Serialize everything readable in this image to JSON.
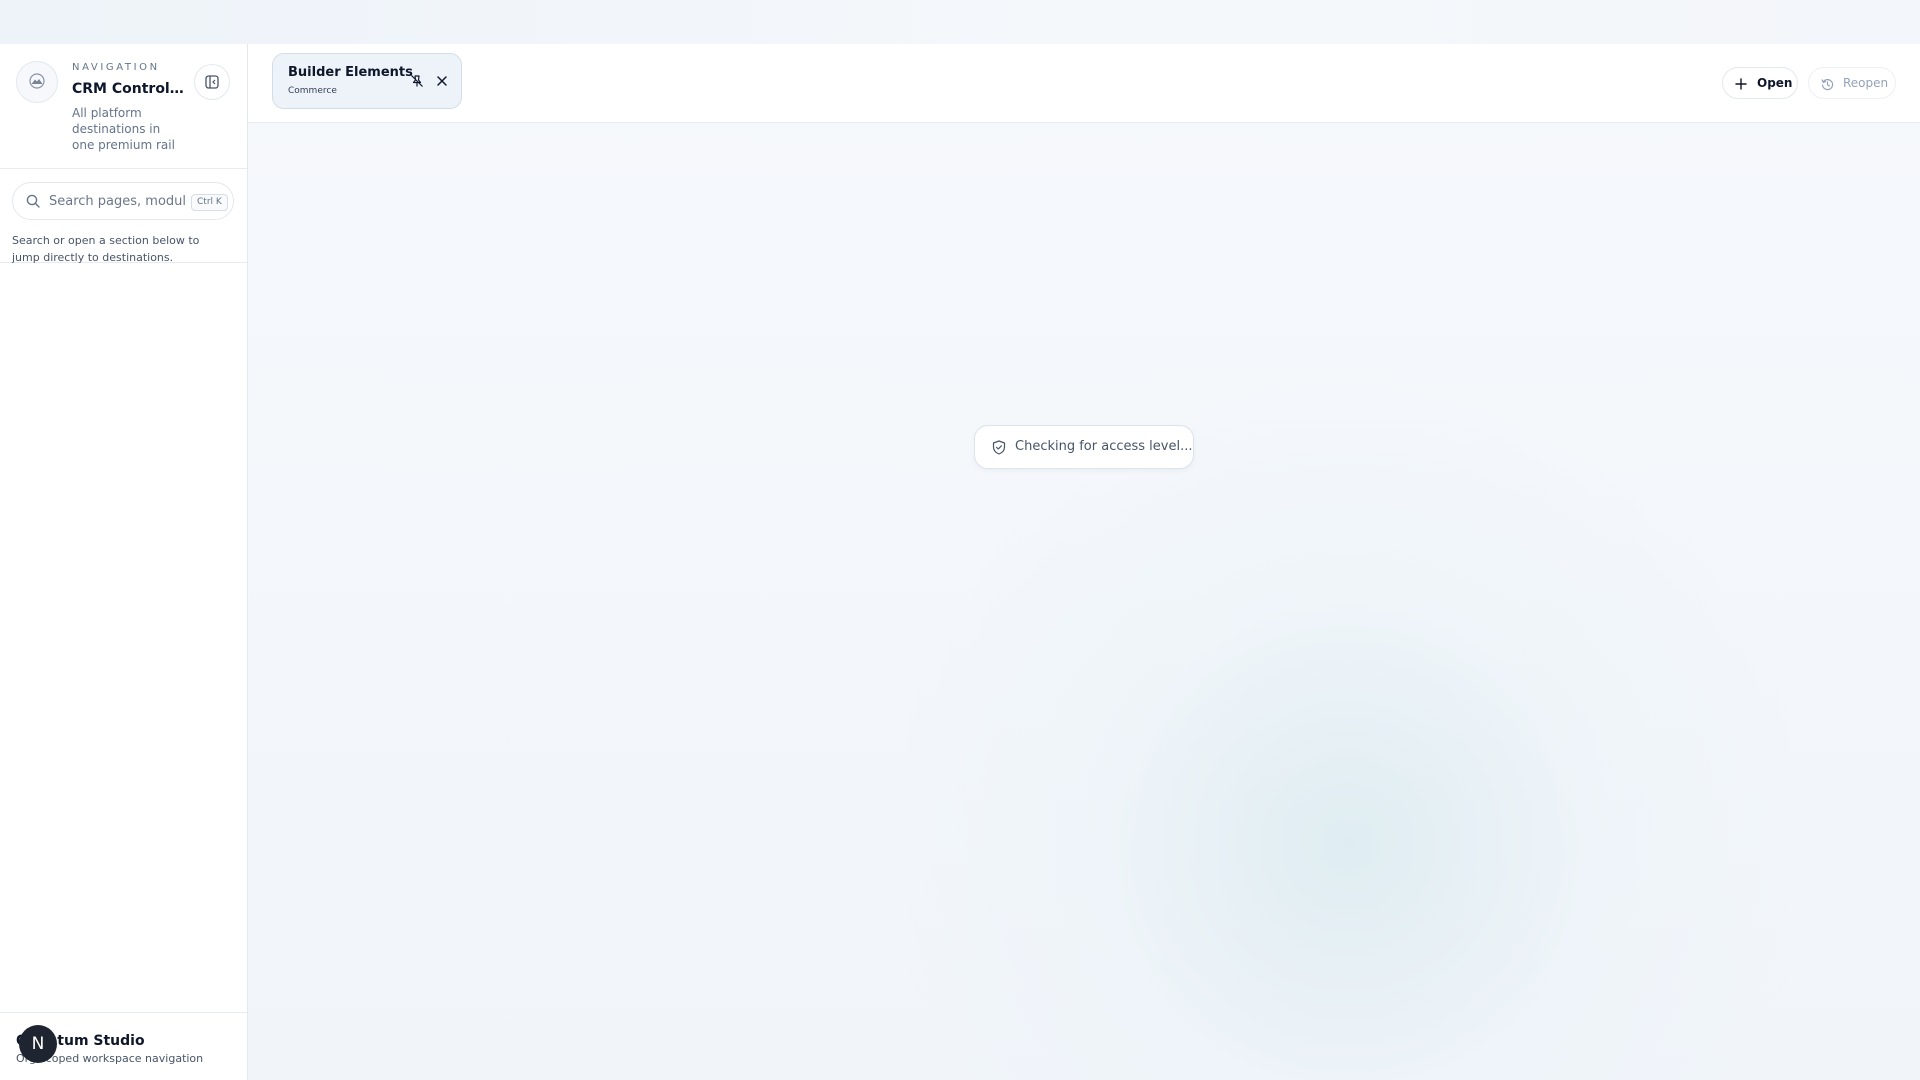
{
  "sidebar": {
    "eyebrow": "NAVIGATION",
    "title": "CRM Control C...",
    "subtitle": "All platform destinations in one premium rail",
    "search": {
      "placeholder": "Search pages, modul",
      "shortcut": "Ctrl K",
      "hint": "Search or open a section below to jump directly to destinations."
    },
    "footer": {
      "title": "Quantum Studio",
      "subtitle": "Org-scoped workspace navigation",
      "avatar_initial": "N"
    }
  },
  "tabs": [
    {
      "title": "Builder Elements",
      "subtitle": "Commerce"
    }
  ],
  "toolbar": {
    "open_label": "Open",
    "reopen_label": "Reopen"
  },
  "status": {
    "message": "Checking for access level..."
  },
  "icons": {
    "logo": "mountain-logo-icon",
    "collapse": "sidebar-collapse-icon",
    "search": "search-icon",
    "unpin": "unpin-icon",
    "close": "close-icon",
    "open": "plus-icon",
    "reopen": "history-icon",
    "status": "shield-check-icon"
  }
}
